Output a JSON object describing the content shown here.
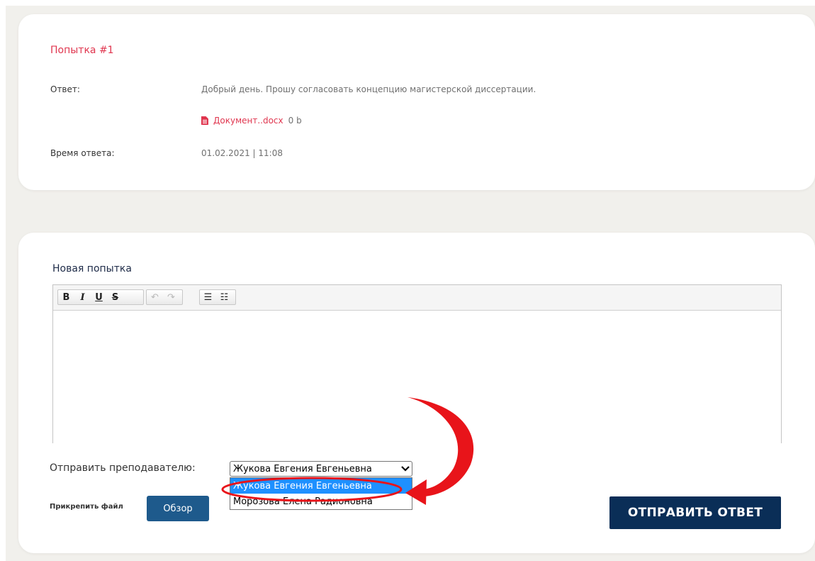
{
  "attempt": {
    "title": "Попытка #1",
    "answer_label": "Ответ:",
    "answer_text": "Добрый день. Прошу согласовать концепцию магистерской диссертации.",
    "file_name": "Документ..docx",
    "file_size": "0 b",
    "time_label": "Время ответа:",
    "time_value": "01.02.2021 | 11:08"
  },
  "new_attempt": {
    "title": "Новая попытка",
    "toolbar": {
      "bold": "B",
      "italic": "I",
      "underline": "U",
      "strike": "S",
      "undo": "↶",
      "redo": "↷",
      "bullet_list": "☰",
      "numbered_list": "☷"
    },
    "send_label": "Отправить преподавателю:",
    "teacher_select": {
      "selected": "Жукова Евгения Евгеньевна",
      "options": [
        "Жукова Евгения Евгеньевна",
        "Морозова Елена Радионовна"
      ]
    },
    "attach_label": "Прикрепить файл",
    "browse_label": "Обзор",
    "submit_label": "ОТПРАВИТЬ ОТВЕТ"
  },
  "colors": {
    "accent_red": "#e0364f",
    "button_blue": "#1e5a8c",
    "submit_navy": "#0a2e57",
    "highlight": "#1e90ff",
    "annotation_red": "#e8141a"
  }
}
